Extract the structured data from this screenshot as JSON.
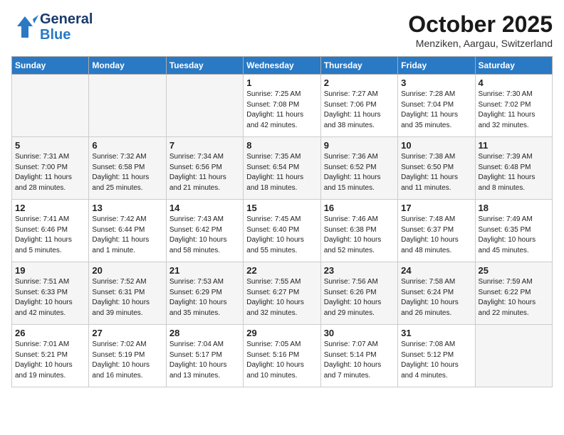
{
  "header": {
    "logo_line1": "General",
    "logo_line2": "Blue",
    "month": "October 2025",
    "location": "Menziken, Aargau, Switzerland"
  },
  "weekdays": [
    "Sunday",
    "Monday",
    "Tuesday",
    "Wednesday",
    "Thursday",
    "Friday",
    "Saturday"
  ],
  "weeks": [
    [
      {
        "day": "",
        "content": ""
      },
      {
        "day": "",
        "content": ""
      },
      {
        "day": "",
        "content": ""
      },
      {
        "day": "1",
        "content": "Sunrise: 7:25 AM\nSunset: 7:08 PM\nDaylight: 11 hours\nand 42 minutes."
      },
      {
        "day": "2",
        "content": "Sunrise: 7:27 AM\nSunset: 7:06 PM\nDaylight: 11 hours\nand 38 minutes."
      },
      {
        "day": "3",
        "content": "Sunrise: 7:28 AM\nSunset: 7:04 PM\nDaylight: 11 hours\nand 35 minutes."
      },
      {
        "day": "4",
        "content": "Sunrise: 7:30 AM\nSunset: 7:02 PM\nDaylight: 11 hours\nand 32 minutes."
      }
    ],
    [
      {
        "day": "5",
        "content": "Sunrise: 7:31 AM\nSunset: 7:00 PM\nDaylight: 11 hours\nand 28 minutes."
      },
      {
        "day": "6",
        "content": "Sunrise: 7:32 AM\nSunset: 6:58 PM\nDaylight: 11 hours\nand 25 minutes."
      },
      {
        "day": "7",
        "content": "Sunrise: 7:34 AM\nSunset: 6:56 PM\nDaylight: 11 hours\nand 21 minutes."
      },
      {
        "day": "8",
        "content": "Sunrise: 7:35 AM\nSunset: 6:54 PM\nDaylight: 11 hours\nand 18 minutes."
      },
      {
        "day": "9",
        "content": "Sunrise: 7:36 AM\nSunset: 6:52 PM\nDaylight: 11 hours\nand 15 minutes."
      },
      {
        "day": "10",
        "content": "Sunrise: 7:38 AM\nSunset: 6:50 PM\nDaylight: 11 hours\nand 11 minutes."
      },
      {
        "day": "11",
        "content": "Sunrise: 7:39 AM\nSunset: 6:48 PM\nDaylight: 11 hours\nand 8 minutes."
      }
    ],
    [
      {
        "day": "12",
        "content": "Sunrise: 7:41 AM\nSunset: 6:46 PM\nDaylight: 11 hours\nand 5 minutes."
      },
      {
        "day": "13",
        "content": "Sunrise: 7:42 AM\nSunset: 6:44 PM\nDaylight: 11 hours\nand 1 minute."
      },
      {
        "day": "14",
        "content": "Sunrise: 7:43 AM\nSunset: 6:42 PM\nDaylight: 10 hours\nand 58 minutes."
      },
      {
        "day": "15",
        "content": "Sunrise: 7:45 AM\nSunset: 6:40 PM\nDaylight: 10 hours\nand 55 minutes."
      },
      {
        "day": "16",
        "content": "Sunrise: 7:46 AM\nSunset: 6:38 PM\nDaylight: 10 hours\nand 52 minutes."
      },
      {
        "day": "17",
        "content": "Sunrise: 7:48 AM\nSunset: 6:37 PM\nDaylight: 10 hours\nand 48 minutes."
      },
      {
        "day": "18",
        "content": "Sunrise: 7:49 AM\nSunset: 6:35 PM\nDaylight: 10 hours\nand 45 minutes."
      }
    ],
    [
      {
        "day": "19",
        "content": "Sunrise: 7:51 AM\nSunset: 6:33 PM\nDaylight: 10 hours\nand 42 minutes."
      },
      {
        "day": "20",
        "content": "Sunrise: 7:52 AM\nSunset: 6:31 PM\nDaylight: 10 hours\nand 39 minutes."
      },
      {
        "day": "21",
        "content": "Sunrise: 7:53 AM\nSunset: 6:29 PM\nDaylight: 10 hours\nand 35 minutes."
      },
      {
        "day": "22",
        "content": "Sunrise: 7:55 AM\nSunset: 6:27 PM\nDaylight: 10 hours\nand 32 minutes."
      },
      {
        "day": "23",
        "content": "Sunrise: 7:56 AM\nSunset: 6:26 PM\nDaylight: 10 hours\nand 29 minutes."
      },
      {
        "day": "24",
        "content": "Sunrise: 7:58 AM\nSunset: 6:24 PM\nDaylight: 10 hours\nand 26 minutes."
      },
      {
        "day": "25",
        "content": "Sunrise: 7:59 AM\nSunset: 6:22 PM\nDaylight: 10 hours\nand 22 minutes."
      }
    ],
    [
      {
        "day": "26",
        "content": "Sunrise: 7:01 AM\nSunset: 5:21 PM\nDaylight: 10 hours\nand 19 minutes."
      },
      {
        "day": "27",
        "content": "Sunrise: 7:02 AM\nSunset: 5:19 PM\nDaylight: 10 hours\nand 16 minutes."
      },
      {
        "day": "28",
        "content": "Sunrise: 7:04 AM\nSunset: 5:17 PM\nDaylight: 10 hours\nand 13 minutes."
      },
      {
        "day": "29",
        "content": "Sunrise: 7:05 AM\nSunset: 5:16 PM\nDaylight: 10 hours\nand 10 minutes."
      },
      {
        "day": "30",
        "content": "Sunrise: 7:07 AM\nSunset: 5:14 PM\nDaylight: 10 hours\nand 7 minutes."
      },
      {
        "day": "31",
        "content": "Sunrise: 7:08 AM\nSunset: 5:12 PM\nDaylight: 10 hours\nand 4 minutes."
      },
      {
        "day": "",
        "content": ""
      }
    ]
  ]
}
